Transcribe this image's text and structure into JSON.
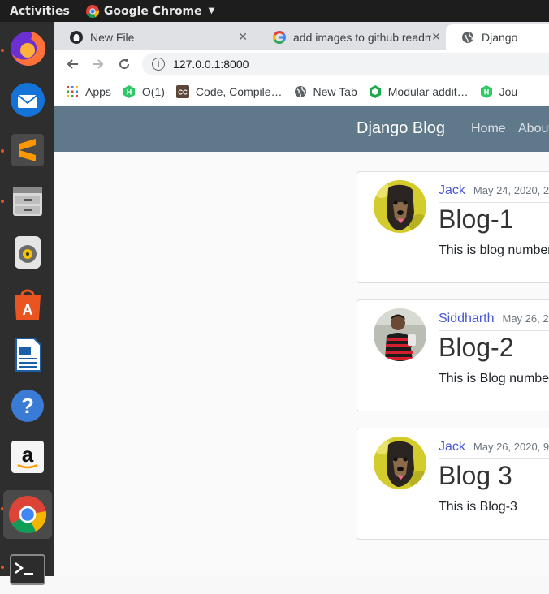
{
  "system_bar": {
    "activities": "Activities",
    "app_name": "Google Chrome"
  },
  "dock": {
    "apps": [
      "firefox-icon",
      "thunderbird-icon",
      "sublime-text-icon",
      "files-icon",
      "rhythmbox-icon",
      "software-center-icon",
      "libreoffice-writer-icon",
      "help-icon",
      "amazon-icon",
      "chrome-icon",
      "terminal-icon"
    ]
  },
  "tabs": [
    {
      "title": "New File",
      "icon": "github-icon"
    },
    {
      "title": "add images to github readme",
      "icon": "google-icon"
    },
    {
      "title": "Django",
      "icon": "globe-icon"
    }
  ],
  "omnibox": {
    "url": "127.0.0.1:8000"
  },
  "bookmarks": [
    {
      "label": "Apps",
      "icon": "apps-grid-icon"
    },
    {
      "label": "O(1)",
      "icon": "hackerrank-icon"
    },
    {
      "label": "Code, Compile…",
      "icon": "codechef-icon"
    },
    {
      "label": "New Tab",
      "icon": "globe-icon"
    },
    {
      "label": "Modular addit…",
      "icon": "cube-icon"
    },
    {
      "label": "Jou",
      "icon": "hackerrank-icon"
    }
  ],
  "site": {
    "brand": "Django Blog",
    "nav": [
      "Home",
      "About"
    ],
    "posts": [
      {
        "author": "Jack",
        "date": "May 24, 2020, 2",
        "title": "Blog-1",
        "body": "This is blog number"
      },
      {
        "author": "Siddharth",
        "date": "May 26, 2",
        "title": "Blog-2",
        "body": "This is Blog numbe"
      },
      {
        "author": "Jack",
        "date": "May 26, 2020, 9",
        "title": "Blog 3",
        "body": "This is Blog-3"
      }
    ]
  },
  "colors": {
    "navbar": "#5f788a",
    "author_link": "#4757d6",
    "dock_indicator": "#e95420"
  }
}
